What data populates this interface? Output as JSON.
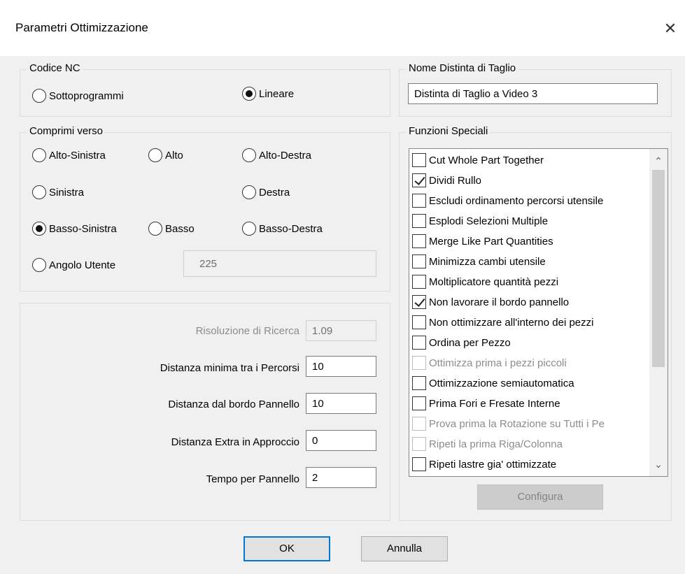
{
  "window": {
    "title": "Parametri Ottimizzazione",
    "close_glyph": "✕"
  },
  "codice_nc": {
    "title": "Codice NC",
    "options": [
      {
        "label": "Sottoprogrammi",
        "selected": false
      },
      {
        "label": "Lineare",
        "selected": true
      }
    ]
  },
  "nome_distinta": {
    "title": "Nome Distinta di Taglio",
    "value": "Distinta di Taglio a Video 3"
  },
  "comprimi_verso": {
    "title": "Comprimi verso",
    "options": {
      "alto_sinistra": {
        "label": "Alto-Sinistra",
        "selected": false
      },
      "alto": {
        "label": "Alto",
        "selected": false
      },
      "alto_destra": {
        "label": "Alto-Destra",
        "selected": false
      },
      "sinistra": {
        "label": "Sinistra",
        "selected": false
      },
      "destra": {
        "label": "Destra",
        "selected": false
      },
      "basso_sinistra": {
        "label": "Basso-Sinistra",
        "selected": true
      },
      "basso": {
        "label": "Basso",
        "selected": false
      },
      "basso_destra": {
        "label": "Basso-Destra",
        "selected": false
      },
      "angolo_utente": {
        "label": "Angolo Utente",
        "selected": false
      }
    },
    "angolo_value": "225"
  },
  "params": {
    "risoluzione": {
      "label": "Risoluzione di Ricerca",
      "value": "1.09"
    },
    "distanza_percorsi": {
      "label": "Distanza minima tra i Percorsi",
      "value": "10"
    },
    "distanza_bordo": {
      "label": "Distanza dal bordo Pannello",
      "value": "10"
    },
    "distanza_extra": {
      "label": "Distanza Extra in Approccio",
      "value": "0"
    },
    "tempo": {
      "label": "Tempo per Pannello",
      "value": "2"
    }
  },
  "funzioni_speciali": {
    "title": "Funzioni Speciali",
    "items": [
      {
        "label": "Cut Whole Part Together",
        "checked": false,
        "enabled": true
      },
      {
        "label": "Dividi Rullo",
        "checked": true,
        "enabled": true
      },
      {
        "label": "Escludi ordinamento percorsi utensile",
        "checked": false,
        "enabled": true
      },
      {
        "label": "Esplodi Selezioni Multiple",
        "checked": false,
        "enabled": true
      },
      {
        "label": "Merge Like Part Quantities",
        "checked": false,
        "enabled": true
      },
      {
        "label": "Minimizza cambi utensile",
        "checked": false,
        "enabled": true
      },
      {
        "label": "Moltiplicatore quantità pezzi",
        "checked": false,
        "enabled": true
      },
      {
        "label": "Non lavorare il bordo pannello",
        "checked": true,
        "enabled": true
      },
      {
        "label": "Non ottimizzare all'interno dei pezzi",
        "checked": false,
        "enabled": true
      },
      {
        "label": "Ordina per Pezzo",
        "checked": false,
        "enabled": true
      },
      {
        "label": "Ottimizza prima i pezzi piccoli",
        "checked": false,
        "enabled": false
      },
      {
        "label": "Ottimizzazione semiautomatica",
        "checked": false,
        "enabled": true
      },
      {
        "label": "Prima Fori e Fresate Interne",
        "checked": false,
        "enabled": true
      },
      {
        "label": "Prova prima la Rotazione su Tutti i Pe",
        "checked": false,
        "enabled": false
      },
      {
        "label": "Ripeti la prima Riga/Colonna",
        "checked": false,
        "enabled": false
      },
      {
        "label": "Ripeti lastre gia' ottimizzate",
        "checked": false,
        "enabled": true
      }
    ],
    "configura_label": "Configura",
    "scroll_up_glyph": "⌃",
    "scroll_down_glyph": "⌄"
  },
  "buttons": {
    "ok": "OK",
    "annulla": "Annulla"
  },
  "colors": {
    "accent": "#0078d7",
    "dialog_bg": "#f0f0f0",
    "disabled_text": "#8c8c8c"
  }
}
